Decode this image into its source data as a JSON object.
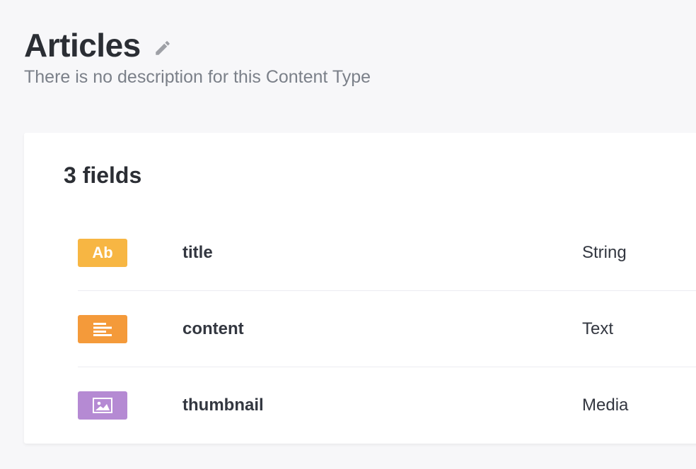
{
  "header": {
    "title": "Articles",
    "description": "There is no description for this Content Type"
  },
  "card": {
    "fields_count": "3 fields",
    "fields": [
      {
        "icon": "string-icon",
        "badge_text": "Ab",
        "badge_color": "#f7b643",
        "name": "title",
        "type": "String"
      },
      {
        "icon": "text-lines-icon",
        "badge_text": "",
        "badge_color": "#f49a3a",
        "name": "content",
        "type": "Text"
      },
      {
        "icon": "image-icon",
        "badge_text": "",
        "badge_color": "#b58ad3",
        "name": "thumbnail",
        "type": "Media"
      }
    ]
  }
}
